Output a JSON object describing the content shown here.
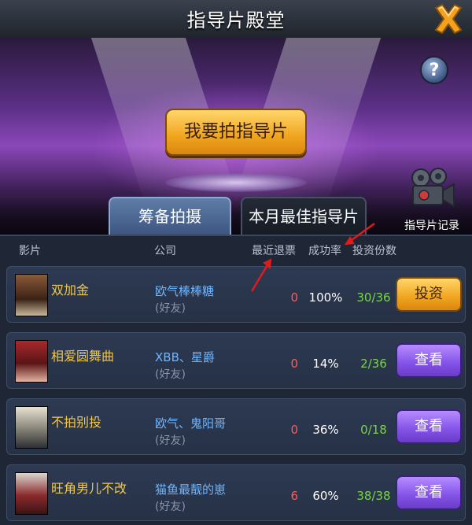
{
  "header": {
    "title": "指导片殿堂",
    "close_icon": "close-x-icon"
  },
  "stage": {
    "main_button_label": "我要拍指导片",
    "help_label": "?",
    "record_label": "指导片记录",
    "record_icon": "film-camera-icon"
  },
  "tabs": [
    {
      "label": "筹备拍摄",
      "active": true
    },
    {
      "label": "本月最佳指导片",
      "active": false
    }
  ],
  "table": {
    "headers": {
      "film": "影片",
      "company": "公司",
      "recent_refund": "最近退票",
      "success_rate": "成功率",
      "shares": "投资份数"
    },
    "rows": [
      {
        "name": "双加金",
        "company": "欧气棒棒糖",
        "friend_tag": "(好友)",
        "refund": "0",
        "rate": "100%",
        "shares": "30/36",
        "action": "投资"
      },
      {
        "name": "相爱圆舞曲",
        "company": "XBB、星爵",
        "friend_tag": "(好友)",
        "refund": "0",
        "rate": "14%",
        "shares": "2/36",
        "action": "查看"
      },
      {
        "name": "不拍别投",
        "company": "欧气、鬼阳哥",
        "friend_tag": "(好友)",
        "refund": "0",
        "rate": "36%",
        "shares": "0/18",
        "action": "查看"
      },
      {
        "name": "旺角男儿不改",
        "company": "猫鱼最靓的崽",
        "friend_tag": "(好友)",
        "refund": "6",
        "rate": "60%",
        "shares": "38/38",
        "action": "查看"
      }
    ]
  },
  "colors": {
    "accent_gold": "#f0a41e",
    "accent_purple": "#8352e6",
    "company_blue": "#6fb6ff",
    "refund_red": "#ff5b5b",
    "shares_green": "#7bd44a",
    "annotation_red": "#e11b1b"
  }
}
